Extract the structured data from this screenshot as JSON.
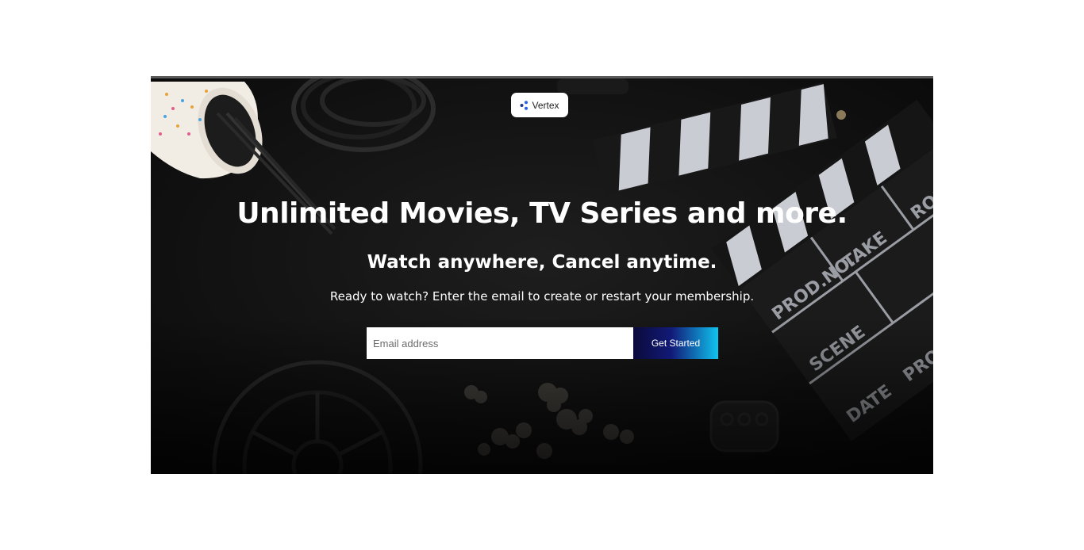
{
  "brand": {
    "name": "Vertex",
    "icon": "vertex-logo-icon"
  },
  "hero": {
    "headline": "Unlimited Movies, TV Series and more.",
    "subheadline": "Watch anywhere, Cancel anytime.",
    "tagline": "Ready to watch? Enter the email to create or restart your membership."
  },
  "signup": {
    "email_placeholder": "Email address",
    "email_value": "",
    "button_label": "Get Started"
  },
  "colors": {
    "background": "#121212",
    "accent_start": "#0a0a3a",
    "accent_end": "#0fc4f0",
    "logo_blue": "#2563eb"
  }
}
